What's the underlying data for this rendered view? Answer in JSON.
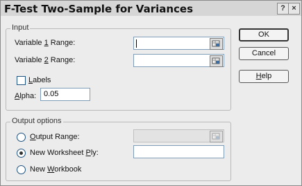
{
  "dialog": {
    "title": "F-Test Two-Sample for Variances",
    "help_glyph": "?",
    "close_glyph": "×"
  },
  "input_group": {
    "label": "Input",
    "var1": {
      "pre": "Variable ",
      "key": "1",
      "post": " Range:",
      "value": ""
    },
    "var2": {
      "pre": "Variable ",
      "key": "2",
      "post": " Range:",
      "value": ""
    },
    "labels": {
      "key": "L",
      "post": "abels",
      "checked": false
    },
    "alpha": {
      "key": "A",
      "post": "lpha:",
      "value": "0.05"
    }
  },
  "buttons": {
    "ok": "OK",
    "cancel": "Cancel",
    "help": {
      "key": "H",
      "post": "elp"
    }
  },
  "output_group": {
    "label": "Output options",
    "output_range": {
      "key": "O",
      "post": "utput Range:",
      "selected": false,
      "value": ""
    },
    "new_worksheet": {
      "pre": "New Worksheet ",
      "key": "P",
      "post": "ly:",
      "selected": true,
      "value": ""
    },
    "new_workbook": {
      "pre": "New ",
      "key": "W",
      "post": "orkbook",
      "selected": false
    }
  },
  "icons": {
    "range_picker": "range-select-icon"
  }
}
